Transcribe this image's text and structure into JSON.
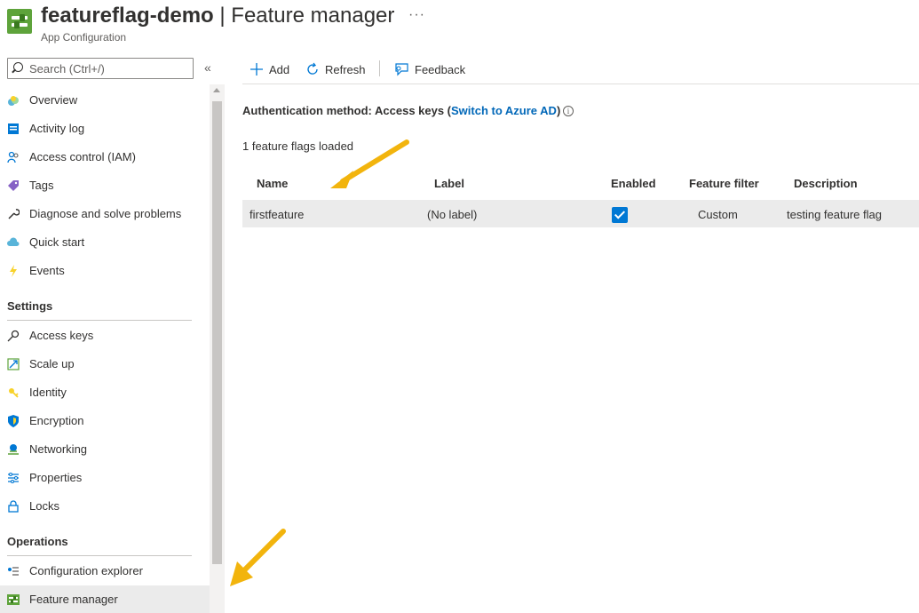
{
  "header": {
    "resource_name": "featureflag-demo",
    "separator": " | ",
    "page_name": "Feature manager",
    "subtitle": "App Configuration",
    "more_label": "···"
  },
  "sidebar": {
    "search_placeholder": "Search (Ctrl+/)",
    "collapse_label": "«",
    "items": [
      {
        "label": "Overview",
        "icon": "overview-icon"
      },
      {
        "label": "Activity log",
        "icon": "activity-log-icon"
      },
      {
        "label": "Access control (IAM)",
        "icon": "people-icon"
      },
      {
        "label": "Tags",
        "icon": "tag-icon"
      },
      {
        "label": "Diagnose and solve problems",
        "icon": "wrench-icon"
      },
      {
        "label": "Quick start",
        "icon": "cloud-icon"
      },
      {
        "label": "Events",
        "icon": "lightning-icon"
      }
    ],
    "settings_title": "Settings",
    "settings_items": [
      {
        "label": "Access keys",
        "icon": "key-icon"
      },
      {
        "label": "Scale up",
        "icon": "scale-up-icon"
      },
      {
        "label": "Identity",
        "icon": "identity-icon"
      },
      {
        "label": "Encryption",
        "icon": "shield-icon"
      },
      {
        "label": "Networking",
        "icon": "network-icon"
      },
      {
        "label": "Properties",
        "icon": "properties-icon"
      },
      {
        "label": "Locks",
        "icon": "lock-icon"
      }
    ],
    "operations_title": "Operations",
    "operations_items": [
      {
        "label": "Configuration explorer",
        "icon": "config-explorer-icon"
      },
      {
        "label": "Feature manager",
        "icon": "feature-manager-icon",
        "active": true
      }
    ]
  },
  "toolbar": {
    "add_label": "Add",
    "refresh_label": "Refresh",
    "feedback_label": "Feedback"
  },
  "main": {
    "auth_prefix": "Authentication method: Access keys (",
    "auth_link": "Switch to Azure AD",
    "auth_suffix": ")",
    "info_glyph": "i",
    "loaded_text": "1 feature flags loaded",
    "columns": [
      "Name",
      "Label",
      "Enabled",
      "Feature filter",
      "Description"
    ],
    "rows": [
      {
        "name": "firstfeature",
        "label": "(No label)",
        "enabled": true,
        "filter": "Custom",
        "description": "testing feature flag"
      }
    ]
  },
  "colors": {
    "accent": "#0078d4",
    "link": "#0067b8",
    "arrow": "#f2b40d",
    "brand_green": "#5ea33b"
  }
}
